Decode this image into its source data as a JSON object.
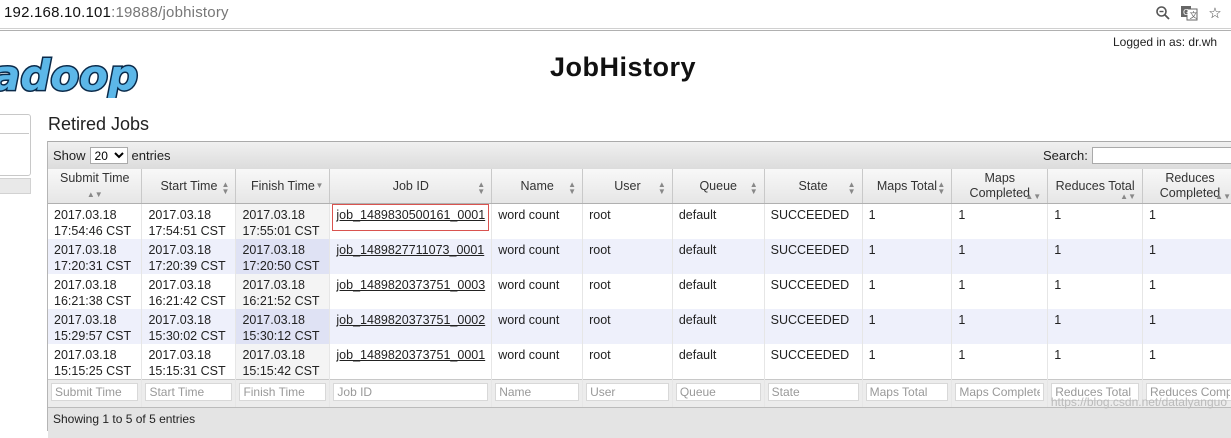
{
  "browser": {
    "url_host": "192.168.10.101",
    "url_rest": ":19888/jobhistory"
  },
  "header": {
    "logged_in": "Logged in as: dr.wh",
    "title": "JobHistory",
    "logo_text": "adoop"
  },
  "section_title": "Retired Jobs",
  "toolbar": {
    "show_label": "Show",
    "entries_value": "20",
    "entries_label": "entries",
    "search_label": "Search:"
  },
  "columns": [
    "Submit Time",
    "Start Time",
    "Finish Time",
    "Job ID",
    "Name",
    "User",
    "Queue",
    "State",
    "Maps Total",
    "Maps Completed",
    "Reduces Total",
    "Reduces Completed"
  ],
  "rows": [
    {
      "submit_date": "2017.03.18",
      "submit_time": "17:54:46 CST",
      "start_date": "2017.03.18",
      "start_time": "17:54:51 CST",
      "finish_date": "2017.03.18",
      "finish_time": "17:55:01 CST",
      "job_id": "job_1489830500161_0001",
      "name": "word count",
      "user": "root",
      "queue": "default",
      "state": "SUCCEEDED",
      "maps_total": "1",
      "maps_completed": "1",
      "reduces_total": "1",
      "reduces_completed": "1"
    },
    {
      "submit_date": "2017.03.18",
      "submit_time": "17:20:31 CST",
      "start_date": "2017.03.18",
      "start_time": "17:20:39 CST",
      "finish_date": "2017.03.18",
      "finish_time": "17:20:50 CST",
      "job_id": "job_1489827711073_0001",
      "name": "word count",
      "user": "root",
      "queue": "default",
      "state": "SUCCEEDED",
      "maps_total": "1",
      "maps_completed": "1",
      "reduces_total": "1",
      "reduces_completed": "1"
    },
    {
      "submit_date": "2017.03.18",
      "submit_time": "16:21:38 CST",
      "start_date": "2017.03.18",
      "start_time": "16:21:42 CST",
      "finish_date": "2017.03.18",
      "finish_time": "16:21:52 CST",
      "job_id": "job_1489820373751_0003",
      "name": "word count",
      "user": "root",
      "queue": "default",
      "state": "SUCCEEDED",
      "maps_total": "1",
      "maps_completed": "1",
      "reduces_total": "1",
      "reduces_completed": "1"
    },
    {
      "submit_date": "2017.03.18",
      "submit_time": "15:29:57 CST",
      "start_date": "2017.03.18",
      "start_time": "15:30:02 CST",
      "finish_date": "2017.03.18",
      "finish_time": "15:30:12 CST",
      "job_id": "job_1489820373751_0002",
      "name": "word count",
      "user": "root",
      "queue": "default",
      "state": "SUCCEEDED",
      "maps_total": "1",
      "maps_completed": "1",
      "reduces_total": "1",
      "reduces_completed": "1"
    },
    {
      "submit_date": "2017.03.18",
      "submit_time": "15:15:25 CST",
      "start_date": "2017.03.18",
      "start_time": "15:15:31 CST",
      "finish_date": "2017.03.18",
      "finish_time": "15:15:42 CST",
      "job_id": "job_1489820373751_0001",
      "name": "word count",
      "user": "root",
      "queue": "default",
      "state": "SUCCEEDED",
      "maps_total": "1",
      "maps_completed": "1",
      "reduces_total": "1",
      "reduces_completed": "1"
    }
  ],
  "filters": [
    "Submit Time",
    "Start Time",
    "Finish Time",
    "Job ID",
    "Name",
    "User",
    "Queue",
    "State",
    "Maps Total",
    "Maps Complete",
    "Reduces Total",
    "Reduces Comp"
  ],
  "info_text": "Showing 1 to 5 of 5 entries",
  "watermark": "https://blog.csdn.net/datalyanguo",
  "colors": {
    "row_alt": "#eef0fb",
    "sorted_col": "#dfe2f4",
    "highlight_box": "#d9534f",
    "logo_fill": "#5cb7e8"
  }
}
